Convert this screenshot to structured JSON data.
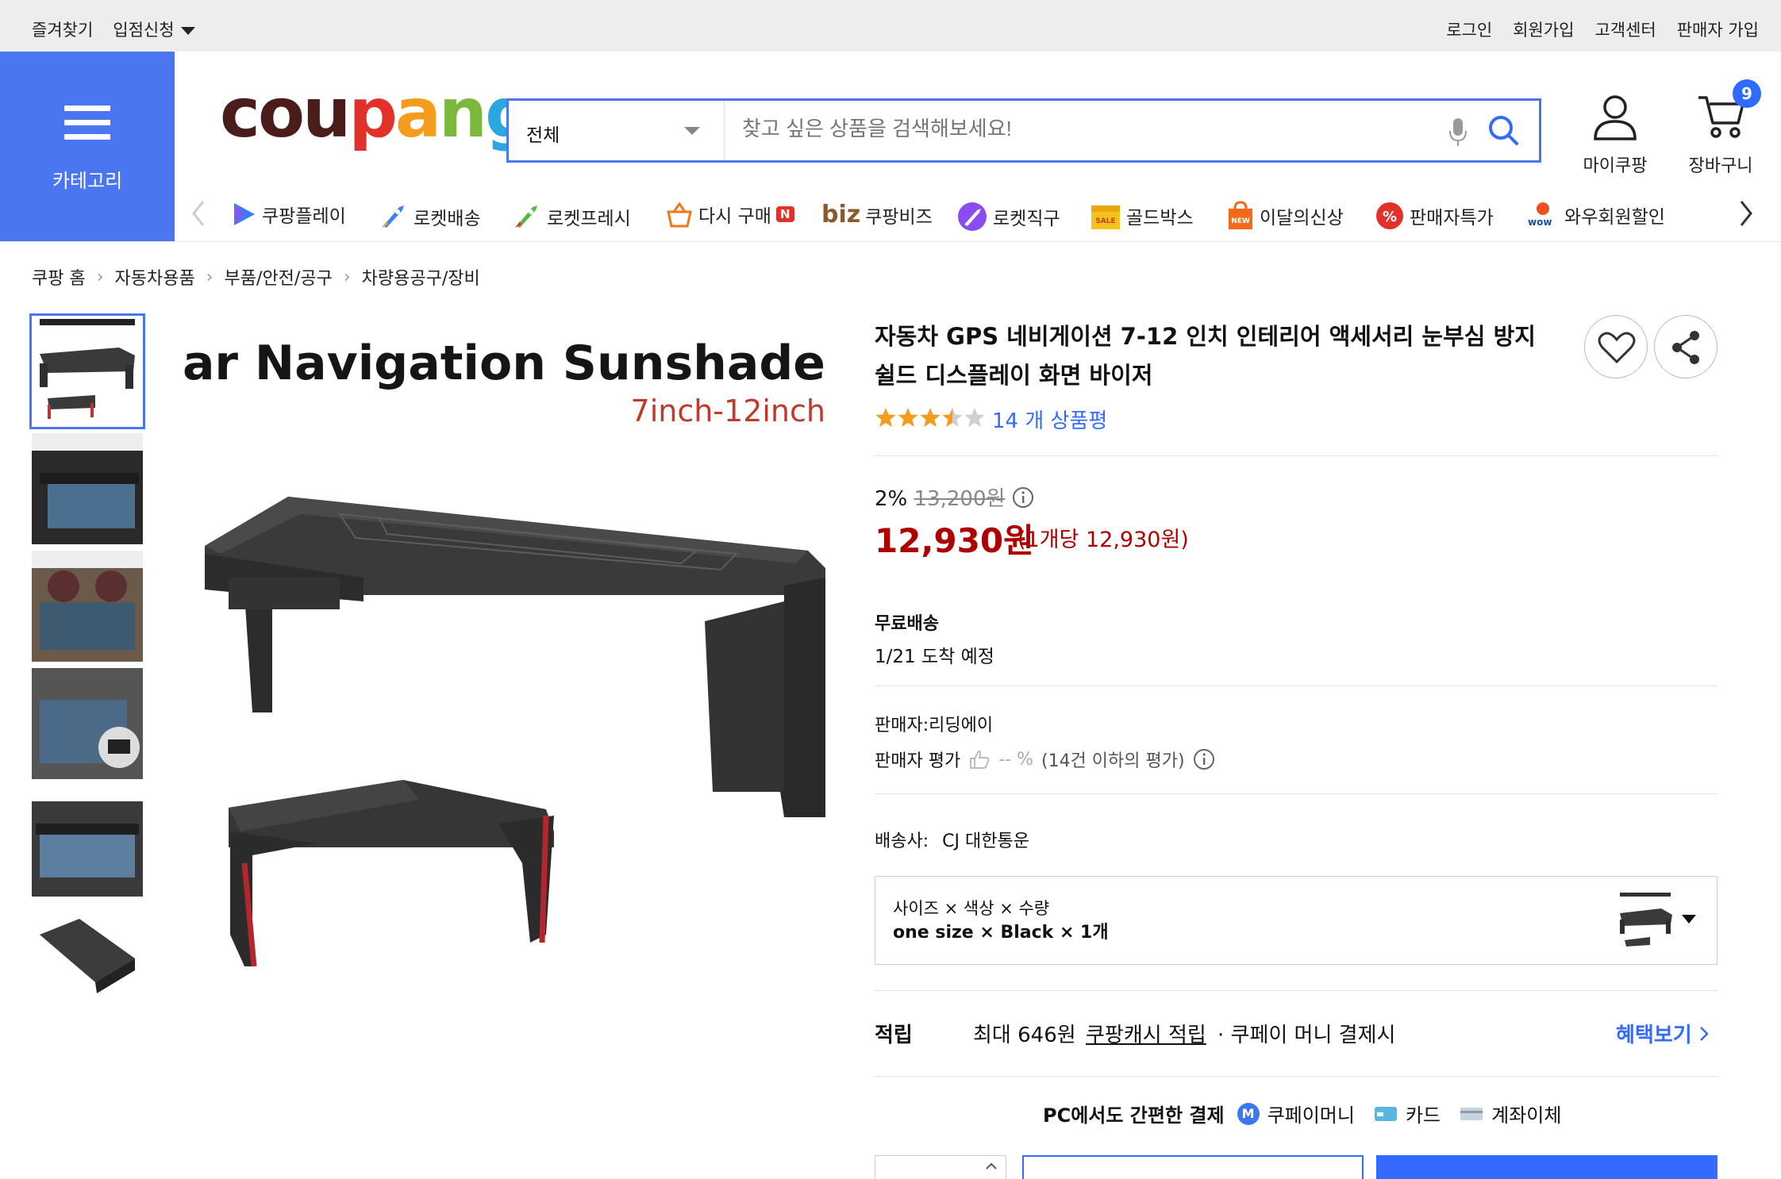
{
  "topbar": {
    "left": [
      "즐겨찾기",
      "입점신청"
    ],
    "right": [
      "로그인",
      "회원가입",
      "고객센터",
      "판매자 가입"
    ]
  },
  "header": {
    "category_label": "카테고리",
    "logo": {
      "c": "c",
      "o": "o",
      "u": "u",
      "p": "p",
      "a": "a",
      "n": "n",
      "g": "g"
    },
    "search": {
      "category": "전체",
      "placeholder": "찾고 싶은 상품을 검색해보세요!"
    },
    "mycoupang": "마이쿠팡",
    "cart": "장바구니",
    "cart_count": "9"
  },
  "nav": {
    "items": [
      "쿠팡플레이",
      "로켓배송",
      "로켓프레시",
      "다시 구매",
      "쿠팡비즈",
      "로켓직구",
      "골드박스",
      "이달의신상",
      "판매자특가",
      "와우회원할인"
    ],
    "reorder_badge": "N",
    "biz_prefix": "biz",
    "wow": "wow"
  },
  "breadcrumb": [
    "쿠팡 홈",
    "자동차용품",
    "부품/안전/공구",
    "차량용공구/장비"
  ],
  "product_image": {
    "headline": "Car Navigation Sunshade",
    "subline": "7inch-12inch"
  },
  "product": {
    "title": "자동차 GPS 네비게이션 7-12 인치 인테리어 액세서리 눈부심 방지 쉴드 디스플레이 화면 바이저",
    "rating": 3.5,
    "review_text": "14 개 상품평",
    "discount_rate": "2%",
    "original_price": "13,200원",
    "price": "12,930원",
    "unit_price": "(1개당 12,930원)",
    "shipping_title": "무료배송",
    "arrival": "1/21 도착 예정",
    "seller": "판매자:리딩에이",
    "seller_rating_label": "판매자 평가",
    "seller_rating_value": "-- %",
    "seller_rating_note": "(14건 이하의 평가)",
    "courier_label": "배송사:",
    "courier": "CJ 대한통운",
    "option_header": "사이즈 × 색상 × 수량",
    "option_value": "one size × Black × 1개",
    "reward_label": "적립",
    "reward_max": "최대 646원",
    "reward_link": "쿠팡캐시 적립",
    "reward_note": "· 쿠페이 머니 결제시",
    "benefit_link": "혜택보기",
    "pay_title": "PC에서도 간편한 결제",
    "pay_methods": [
      "쿠페이머니",
      "카드",
      "계좌이체"
    ],
    "pay_m": "M"
  },
  "colors": {
    "accent": "#4a76f1",
    "price": "#ae0000",
    "link": "#346aff"
  }
}
